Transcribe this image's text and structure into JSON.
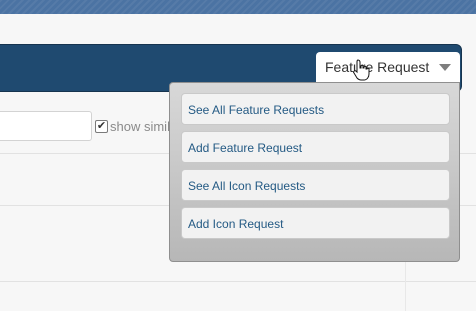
{
  "header": {
    "filter_checkbox_label": "show simil"
  },
  "dropdown": {
    "selected_label": "Feature Request",
    "caret_icon": "caret-down-icon",
    "items": [
      {
        "label": "See All Feature Requests"
      },
      {
        "label": "Add Feature Request"
      },
      {
        "label": "See All Icon Requests"
      },
      {
        "label": "Add Icon Request"
      }
    ]
  },
  "colors": {
    "navbar": "#1f4a70",
    "link": "#245a84",
    "top_strip": "#4b73a3"
  }
}
